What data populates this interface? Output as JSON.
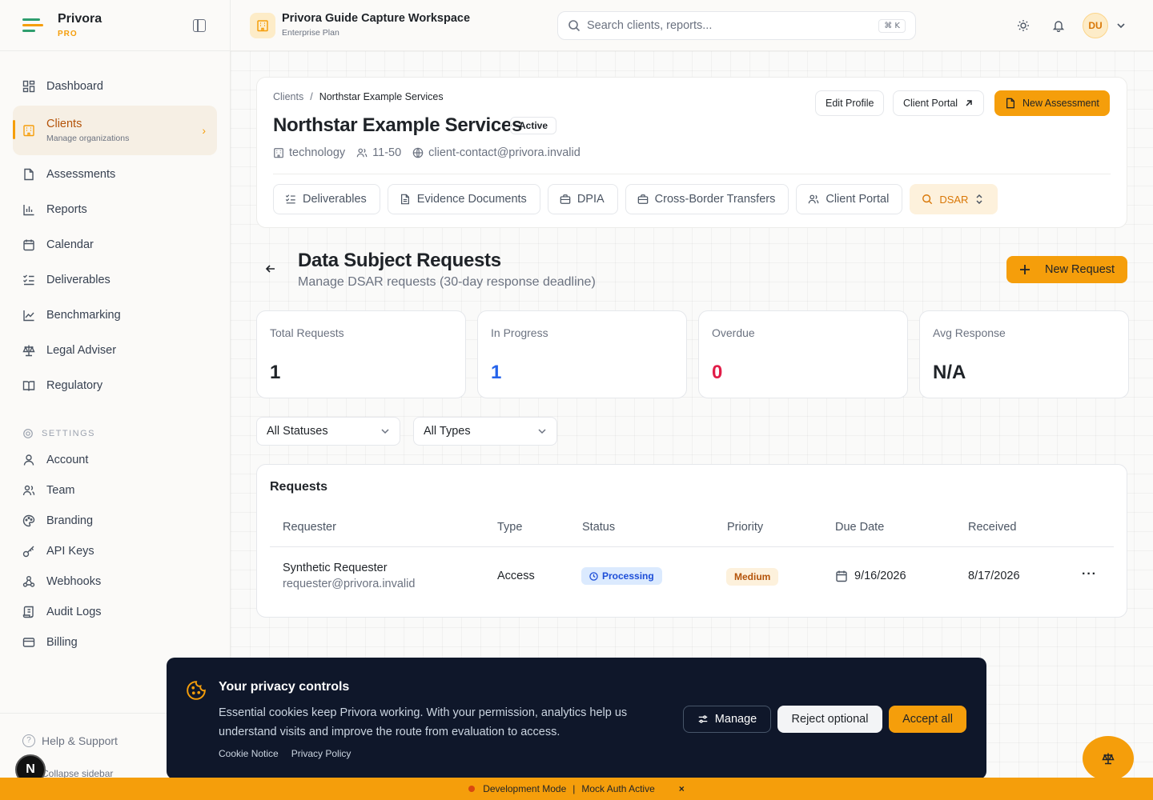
{
  "brand": {
    "name": "Privora",
    "tier": "PRO"
  },
  "topbar": {
    "workspace_title": "Privora Guide Capture Workspace",
    "workspace_plan": "Enterprise Plan",
    "search_placeholder": "Search clients, reports...",
    "search_shortcut": "⌘ K",
    "user_initials": "DU"
  },
  "sidebar": {
    "items": [
      {
        "label": "Dashboard",
        "icon": "dashboard-icon"
      },
      {
        "label": "Clients",
        "sub": "Manage organizations",
        "icon": "building-icon",
        "active": true
      },
      {
        "label": "Assessments",
        "icon": "document-icon"
      },
      {
        "label": "Reports",
        "icon": "bar-chart-icon"
      },
      {
        "label": "Calendar",
        "icon": "calendar-icon"
      },
      {
        "label": "Deliverables",
        "icon": "checklist-icon"
      },
      {
        "label": "Benchmarking",
        "icon": "line-chart-icon"
      },
      {
        "label": "Legal Adviser",
        "icon": "scale-icon"
      },
      {
        "label": "Regulatory",
        "icon": "book-icon"
      }
    ],
    "settings_label": "SETTINGS",
    "settings_items": [
      {
        "label": "Account",
        "icon": "user-icon"
      },
      {
        "label": "Team",
        "icon": "users-icon"
      },
      {
        "label": "Branding",
        "icon": "palette-icon"
      },
      {
        "label": "API Keys",
        "icon": "key-icon"
      },
      {
        "label": "Webhooks",
        "icon": "webhook-icon"
      },
      {
        "label": "Audit Logs",
        "icon": "scroll-icon"
      },
      {
        "label": "Billing",
        "icon": "credit-card-icon"
      }
    ],
    "help_label": "Help & Support",
    "collapse_label": "Collapse sidebar"
  },
  "client": {
    "breadcrumb_root": "Clients",
    "breadcrumb_sep": "/",
    "breadcrumb_current": "Northstar Example Services",
    "name": "Northstar Example Services",
    "status": "Active",
    "industry": "technology",
    "size": "11-50",
    "email": "client-contact@privora.invalid",
    "actions": {
      "edit": "Edit Profile",
      "portal": "Client Portal",
      "new_assessment": "New Assessment"
    },
    "tabs": [
      "Deliverables",
      "Evidence Documents",
      "DPIA",
      "Cross-Border Transfers",
      "Client Portal"
    ],
    "active_tab": "DSAR"
  },
  "dsr": {
    "title": "Data Subject Requests",
    "subtitle": "Manage DSAR requests (30-day response deadline)",
    "new_request_label": "New Request",
    "stats": [
      {
        "label": "Total Requests",
        "value": "1",
        "color": "#1f2328"
      },
      {
        "label": "In Progress",
        "value": "1",
        "color": "#2563eb"
      },
      {
        "label": "Overdue",
        "value": "0",
        "color": "#e11d48"
      },
      {
        "label": "Avg Response",
        "value": "N/A",
        "color": "#1f2328"
      }
    ],
    "filters": {
      "status": "All Statuses",
      "type": "All Types"
    },
    "table": {
      "title": "Requests",
      "columns": [
        "Requester",
        "Type",
        "Status",
        "Priority",
        "Due Date",
        "Received"
      ],
      "rows": [
        {
          "requester_name": "Synthetic Requester",
          "requester_email": "requester@privora.invalid",
          "type": "Access",
          "status": "Processing",
          "priority": "Medium",
          "due_date": "9/16/2026",
          "received": "8/17/2026"
        }
      ]
    }
  },
  "cookie": {
    "title": "Your privacy controls",
    "text": "Essential cookies keep Privora working. With your permission, analytics help us understand visits and improve the route from evaluation to access.",
    "links": [
      "Cookie Notice",
      "Privacy Policy"
    ],
    "manage": "Manage",
    "reject": "Reject optional",
    "accept": "Accept all"
  },
  "devbar": {
    "mode": "Development Mode",
    "sep": "|",
    "auth": "Mock Auth Active",
    "close": "×"
  },
  "avatar_letter": "N",
  "colors": {
    "accent": "#f59e0b",
    "banner_bg": "#0f172a"
  }
}
